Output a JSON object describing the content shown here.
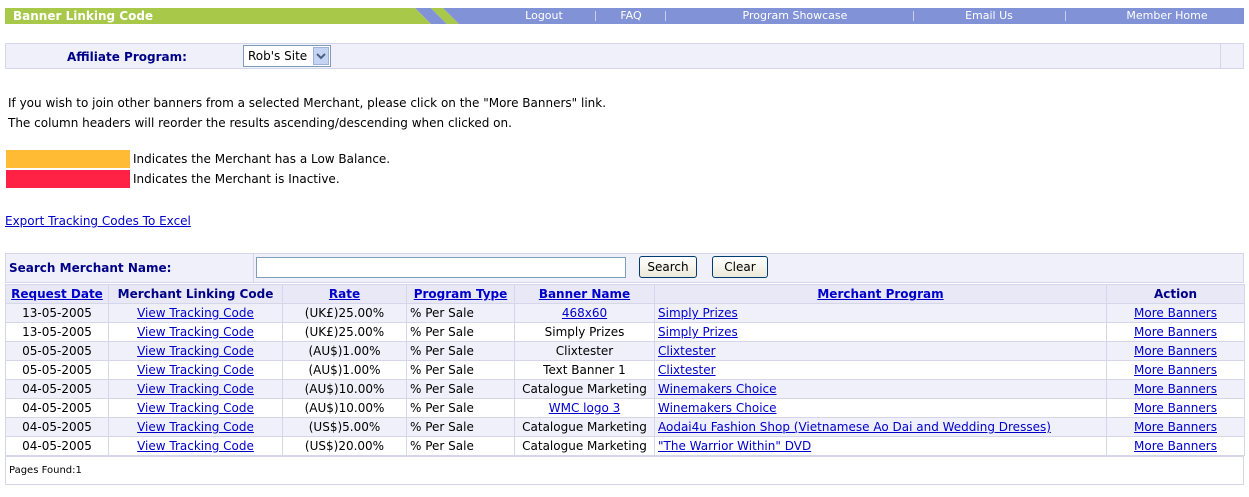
{
  "header": {
    "title": "Banner Linking Code",
    "nav": [
      "Logout",
      "FAQ",
      "Program Showcase",
      "Email Us",
      "Member Home"
    ],
    "colors": {
      "green": "#a8c84a",
      "blue": "#8193d6"
    }
  },
  "affiliate": {
    "label": "Affiliate Program:",
    "selected": "Rob's Site"
  },
  "info": {
    "line1": "If you wish to join other banners from a selected Merchant, please click on the \"More Banners\" link.",
    "line2": "The column headers will reorder the results ascending/descending when clicked on."
  },
  "legend": [
    {
      "color": "#ffbb33",
      "text": "Indicates the Merchant has a Low Balance."
    },
    {
      "color": "#ff2244",
      "text": "Indicates the Merchant is Inactive."
    }
  ],
  "export_link": "Export Tracking Codes To Excel",
  "search": {
    "label": "Search Merchant Name:",
    "value": "",
    "search_button": "Search",
    "clear_button": "Clear"
  },
  "table": {
    "headers": [
      "Request Date",
      "Merchant Linking Code",
      "Rate",
      "Program Type",
      "Banner Name",
      "Merchant Program",
      "Action"
    ],
    "rows": [
      {
        "date": "13-05-2005",
        "code": "View Tracking Code",
        "rate": "(UK£)25.00%",
        "type": "% Per Sale",
        "banner": "468x60",
        "banner_link": true,
        "program": "Simply Prizes",
        "action": "More Banners"
      },
      {
        "date": "13-05-2005",
        "code": "View Tracking Code",
        "rate": "(UK£)25.00%",
        "type": "% Per Sale",
        "banner": "Simply Prizes",
        "banner_link": false,
        "program": "Simply Prizes",
        "action": "More Banners"
      },
      {
        "date": "05-05-2005",
        "code": "View Tracking Code",
        "rate": "(AU$)1.00%",
        "type": "% Per Sale",
        "banner": "Clixtester",
        "banner_link": false,
        "program": "Clixtester",
        "action": "More Banners"
      },
      {
        "date": "05-05-2005",
        "code": "View Tracking Code",
        "rate": "(AU$)1.00%",
        "type": "% Per Sale",
        "banner": "Text Banner 1",
        "banner_link": false,
        "program": "Clixtester",
        "action": "More Banners"
      },
      {
        "date": "04-05-2005",
        "code": "View Tracking Code",
        "rate": "(AU$)10.00%",
        "type": "% Per Sale",
        "banner": "Catalogue Marketing",
        "banner_link": false,
        "program": "Winemakers Choice",
        "action": "More Banners"
      },
      {
        "date": "04-05-2005",
        "code": "View Tracking Code",
        "rate": "(AU$)10.00%",
        "type": "% Per Sale",
        "banner": "WMC logo 3",
        "banner_link": true,
        "program": "Winemakers Choice",
        "action": "More Banners"
      },
      {
        "date": "04-05-2005",
        "code": "View Tracking Code",
        "rate": "(US$)5.00%",
        "type": "% Per Sale",
        "banner": "Catalogue Marketing",
        "banner_link": false,
        "program": "Aodai4u Fashion Shop (Vietnamese Ao Dai and Wedding Dresses)",
        "action": "More Banners"
      },
      {
        "date": "04-05-2005",
        "code": "View Tracking Code",
        "rate": "(US$)20.00%",
        "type": "% Per Sale",
        "banner": "Catalogue Marketing",
        "banner_link": false,
        "program": "\"The Warrior Within\" DVD",
        "action": "More Banners"
      }
    ]
  },
  "pages_found": "Pages Found:1"
}
